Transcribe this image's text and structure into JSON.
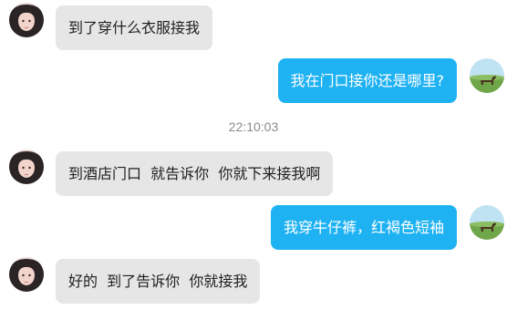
{
  "conversation": {
    "messages": [
      {
        "direction": "incoming",
        "text": "到了穿什么衣服接我"
      },
      {
        "direction": "outgoing",
        "text": "我在门口接你还是哪里?"
      },
      {
        "direction": "incoming",
        "text": "到酒店门口  就告诉你  你就下来接我啊"
      },
      {
        "direction": "outgoing",
        "text": "我穿牛仔裤，红褐色短袖"
      },
      {
        "direction": "incoming",
        "text": "好的  到了告诉你  你就接我"
      }
    ],
    "timestamp": "22:10:03"
  },
  "avatars": {
    "contact": "woman-portrait-avatar",
    "self": "landscape-horse-avatar"
  },
  "colors": {
    "incoming_bubble": "#e6e6e6",
    "outgoing_bubble": "#1fb2f3"
  }
}
